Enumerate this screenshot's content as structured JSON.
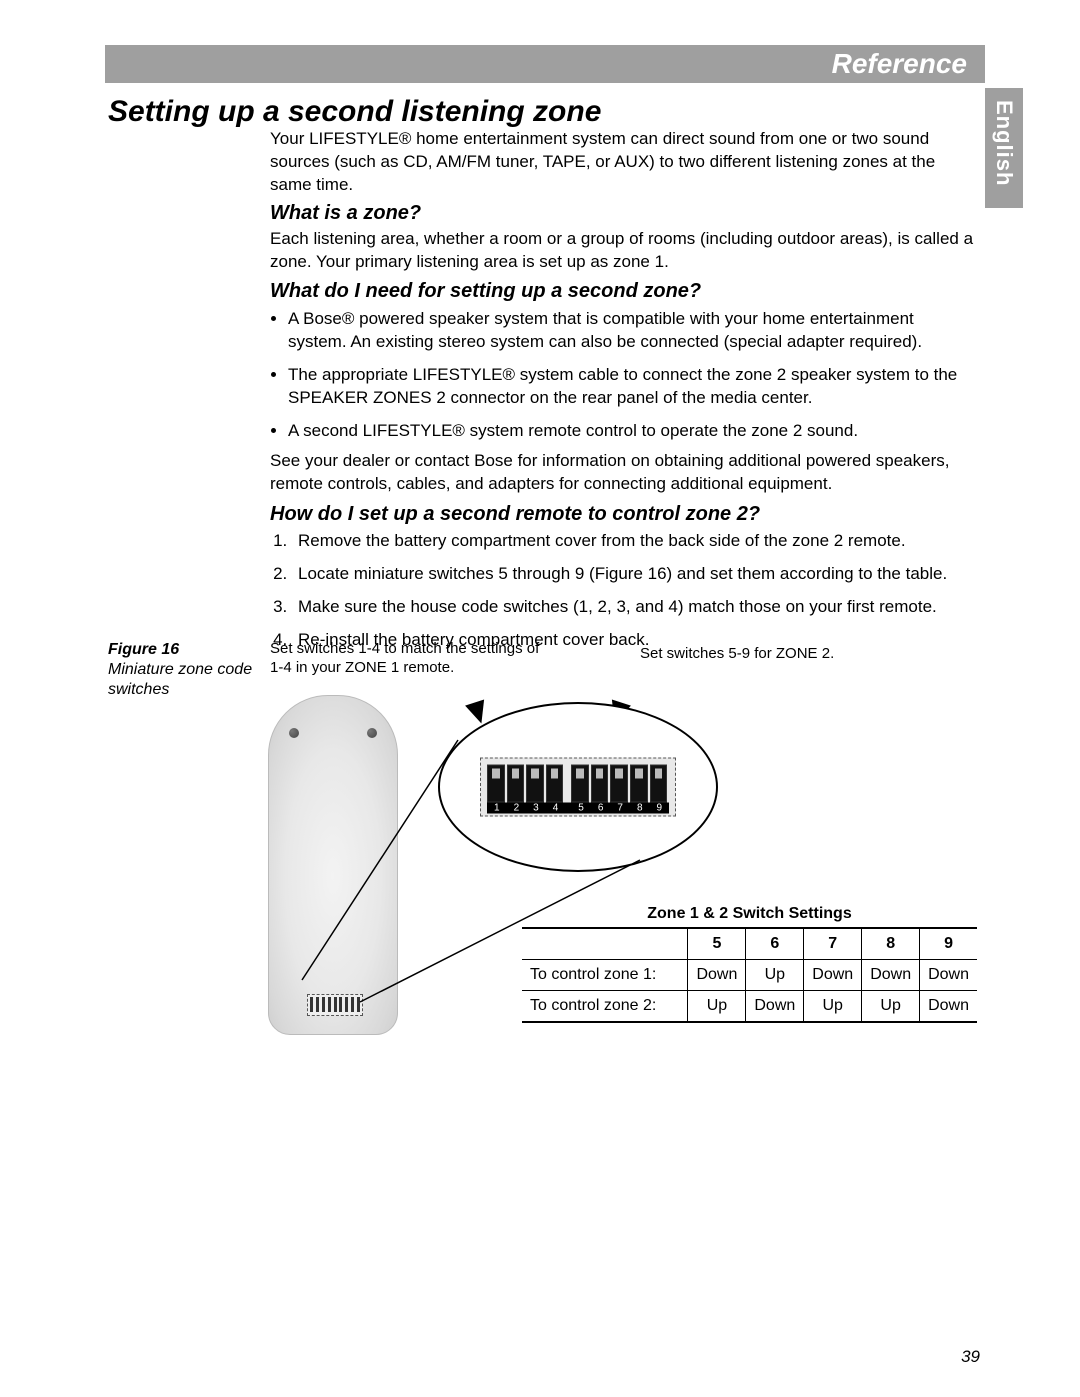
{
  "header": {
    "section": "Reference"
  },
  "side_tab": "English",
  "page_number": "39",
  "title": "Setting up a second listening zone",
  "intro": "Your LIFESTYLE® home entertainment system can direct sound from one or two sound sources (such as CD, AM/FM tuner, TAPE, or AUX) to two different listening zones at the same time.",
  "sections": {
    "what_is_zone": {
      "heading": "What is a zone?",
      "body": "Each listening area, whether a room or a group of rooms (including outdoor areas), is called a zone. Your primary listening area is set up as zone 1."
    },
    "need": {
      "heading": "What do I need for setting up a second zone?",
      "bullets": [
        "A Bose® powered speaker system that is compatible with your home entertainment system. An existing stereo system can also be connected (special adapter required).",
        "The appropriate LIFESTYLE® system cable to connect the zone 2 speaker system to the SPEAKER ZONES 2 connector on the rear panel of the media center.",
        "A second LIFESTYLE® system remote control to operate the zone 2 sound."
      ],
      "dealer": "See your dealer or contact Bose for information on obtaining additional powered speakers, remote controls, cables, and adapters for connecting additional equipment."
    },
    "setup_remote": {
      "heading": "How do I set up a second remote to control zone 2?",
      "steps": [
        "Remove the battery compartment cover from the back side of the zone 2 remote.",
        "Locate miniature switches 5 through 9 (Figure 16) and set them according to the table.",
        "Make sure the house code switches (1, 2, 3, and 4) match those on your first remote.",
        "Re-install the battery compartment cover back."
      ]
    }
  },
  "figure": {
    "title": "Figure 16",
    "caption": "Miniature zone code switches",
    "callout_left": "Set switches 1-4 to match the settings of 1-4 in your ZONE 1 remote.",
    "callout_right": "Set switches 5-9 for ZONE 2.",
    "dip_labels": [
      "1",
      "2",
      "3",
      "4",
      "5",
      "6",
      "7",
      "8",
      "9"
    ]
  },
  "switch_table": {
    "title": "Zone 1 & 2 Switch Settings",
    "columns": [
      "5",
      "6",
      "7",
      "8",
      "9"
    ],
    "rows": [
      {
        "label": "To control zone 1:",
        "values": [
          "Down",
          "Up",
          "Down",
          "Down",
          "Down"
        ]
      },
      {
        "label": "To control zone 2:",
        "values": [
          "Up",
          "Down",
          "Up",
          "Up",
          "Down"
        ]
      }
    ]
  }
}
